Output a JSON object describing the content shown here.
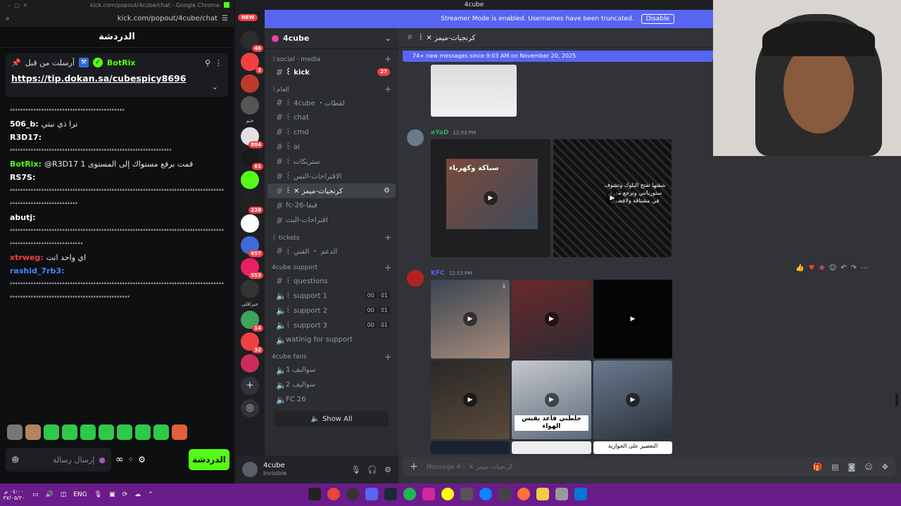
{
  "kick": {
    "window_title": "kick.com/popout/4cube/chat - Google Chrome",
    "url": "kick.com/popout/4cube/chat",
    "chat_title": "الدردشة",
    "pinned": {
      "sent_by": "أرسلت من قبل",
      "bot": "BotRix",
      "link": "https://tip.dokan.sa/cubespicy8696"
    },
    "messages": [
      {
        "user": "",
        "color": "#ffffff",
        "text": "",
        "emotes": "⁴⁴⁴⁴⁴⁴⁴⁴⁴⁴⁴⁴⁴⁴⁴⁴⁴⁴⁴⁴⁴⁴⁴⁴⁴⁴⁴⁴⁴⁴⁴⁴⁴⁴⁴⁴⁴⁴⁴⁴⁴⁴⁴⁴"
      },
      {
        "user": "506_b:",
        "color": "#ffffff",
        "text": "ترا ذي نبتي",
        "emotes": ""
      },
      {
        "user": "R3D17:",
        "color": "#ffffff",
        "text": "",
        "emotes": "⁴⁴⁴⁴⁴⁴⁴⁴⁴⁴⁴⁴⁴⁴⁴⁴⁴⁴⁴⁴⁴⁴⁴⁴⁴⁴⁴⁴⁴⁴⁴⁴⁴⁴⁴⁴⁴⁴⁴⁴⁴⁴⁴⁴⁴⁴⁴⁴⁴⁴⁴⁴⁴⁴⁴⁴⁴⁴⁴⁴⁴⁴"
      },
      {
        "user": "BotRix:",
        "color": "#53fc18",
        "text": "@R3D17 قمت برفع مستواك إلى المستوى 1",
        "emotes": ""
      },
      {
        "user": "RS7S:",
        "color": "#ffffff",
        "text": "",
        "emotes": "⁴⁴⁴⁴⁴⁴⁴⁴⁴⁴⁴⁴⁴⁴⁴⁴⁴⁴⁴⁴⁴⁴⁴⁴⁴⁴⁴⁴⁴⁴⁴⁴⁴⁴⁴⁴⁴⁴⁴⁴⁴⁴⁴⁴⁴⁴⁴⁴⁴⁴⁴⁴⁴⁴⁴⁴⁴⁴⁴⁴⁴⁴⁴⁴⁴⁴⁴⁴⁴⁴⁴⁴⁴⁴⁴⁴⁴⁴⁴⁴⁴⁴⁴⁴⁴⁴⁴⁴⁴⁴⁴⁴⁴⁴⁴⁴⁴⁴⁴⁴⁴⁴⁴⁴⁴⁴⁴⁴"
      },
      {
        "user": "abutj:",
        "color": "#ffffff",
        "text": "",
        "emotes": "⁴⁴⁴⁴⁴⁴⁴⁴⁴⁴⁴⁴⁴⁴⁴⁴⁴⁴⁴⁴⁴⁴⁴⁴⁴⁴⁴⁴⁴⁴⁴⁴⁴⁴⁴⁴⁴⁴⁴⁴⁴⁴⁴⁴⁴⁴⁴⁴⁴⁴⁴⁴⁴⁴⁴⁴⁴⁴⁴⁴⁴⁴⁴⁴⁴⁴⁴⁴⁴⁴⁴⁴⁴⁴⁴⁴⁴⁴⁴⁴⁴⁴⁴⁴⁴⁴⁴⁴⁴⁴⁴⁴⁴⁴⁴⁴⁴⁴⁴⁴⁴⁴⁴⁴⁴⁴⁴⁴⁴⁴"
      },
      {
        "user": "xtrweg:",
        "color": "#f23f43",
        "text": "اي واحد انت",
        "emotes": ""
      },
      {
        "user": "rashid_7rb3:",
        "color": "#3d8bfd",
        "text": "",
        "emotes": "⁴⁴⁴⁴⁴⁴⁴⁴⁴⁴⁴⁴⁴⁴⁴⁴⁴⁴⁴⁴⁴⁴⁴⁴⁴⁴⁴⁴⁴⁴⁴⁴⁴⁴⁴⁴⁴⁴⁴⁴⁴⁴⁴⁴⁴⁴⁴⁴⁴⁴⁴⁴⁴⁴⁴⁴⁴⁴⁴⁴⁴⁴⁴⁴⁴⁴⁴⁴⁴⁴⁴⁴⁴⁴⁴⁴⁴⁴⁴⁴⁴⁴⁴⁴⁴⁴⁴⁴⁴⁴⁴⁴⁴⁴⁴⁴⁴⁴⁴⁴⁴⁴⁴⁴⁴⁴⁴⁴⁴⁴⁴⁴⁴⁴⁴⁴⁴⁴⁴⁴⁴⁴⁴⁴⁴⁴⁴⁴"
      }
    ],
    "input_placeholder": "إرسال رسالة",
    "send_label": "الدردشة"
  },
  "discord": {
    "window_title": "4cube",
    "new_badge": "NEW",
    "streamer_mode_text": "Streamer Mode is enabled. Usernames have been truncated.",
    "disable_label": "Disable",
    "server_name": "4cube",
    "guild_badges": [
      "46",
      "3",
      "",
      "",
      "884",
      "61",
      "",
      "238",
      "",
      "657",
      "553",
      "",
      "14",
      "32",
      ""
    ],
    "guild_labels": [
      "ختم",
      "",
      "جيزاقلي",
      "وشتل"
    ],
    "categories": [
      {
        "name": "꒰social · media",
        "channels": [
          {
            "name": "꒰ kick",
            "count": "27",
            "type": "text",
            "unread": true
          }
        ]
      },
      {
        "name": "꒰العام",
        "channels": [
          {
            "name": "꒰ 4cube ・لقطات",
            "type": "text"
          },
          {
            "name": "꒰ chat",
            "type": "text"
          },
          {
            "name": "꒰ cmd",
            "type": "text"
          },
          {
            "name": "꒰ ai",
            "type": "text"
          },
          {
            "name": "꒰ ستريكات",
            "type": "text"
          },
          {
            "name": "꒰ الاقتراحات-النس",
            "type": "text"
          },
          {
            "name": "꒰ ✕ كرنجيات-ميمز",
            "type": "text",
            "selected": true
          },
          {
            "name": "fc-26-فيفا",
            "type": "text"
          },
          {
            "name": "اقتراحات-البث",
            "type": "text"
          }
        ]
      },
      {
        "name": "꒰ tickets",
        "channels": [
          {
            "name": "꒰ الدعم ・ الفني",
            "type": "text"
          }
        ]
      },
      {
        "name": "4cube support",
        "channels": [
          {
            "name": "꒰ questions",
            "type": "text"
          },
          {
            "name": "꒰ support 1",
            "type": "voice",
            "a": "00",
            "b": "01"
          },
          {
            "name": "꒰ support 2",
            "type": "voice",
            "a": "00",
            "b": "01"
          },
          {
            "name": "꒰ support 3",
            "type": "voice",
            "a": "00",
            "b": "01"
          },
          {
            "name": "watinig for support",
            "type": "voice"
          }
        ]
      },
      {
        "name": "4cube fans",
        "channels": [
          {
            "name": "سواليف 1",
            "type": "voice"
          },
          {
            "name": "سواليف 2",
            "type": "voice"
          },
          {
            "name": "FC 26",
            "type": "voice"
          }
        ]
      }
    ],
    "show_all": "Show All",
    "user": {
      "name": "4cube",
      "status": "Invisible"
    },
    "channel_header": "꒰ ✕ كرنجيات-ميمز",
    "new_messages": "74+ new messages since 9:03 AM on November 20, 2025",
    "posts": [
      {
        "author": "eYaD",
        "time": "12:53 PM",
        "color": "#3ba55d"
      },
      {
        "author": "KFC",
        "time": "12:53 PM",
        "color": "#5865f2"
      }
    ],
    "media_captions": [
      "شقتها تفتح البلوك وتشوف ستوريانتي وترجع مدري في مشتاقة ولافضول",
      "سباكة وكهرباء",
      "جلطني قاعد يقبس الهواء",
      "التعصير على الجوازية"
    ],
    "composer_placeholder": "Message #꒰ ✕ كرنجيات-ميمز"
  },
  "taskbar": {
    "time": "٠٤:٠٠ م",
    "date": "٢٧/٠٥/٢٠",
    "lang": "ENG"
  }
}
